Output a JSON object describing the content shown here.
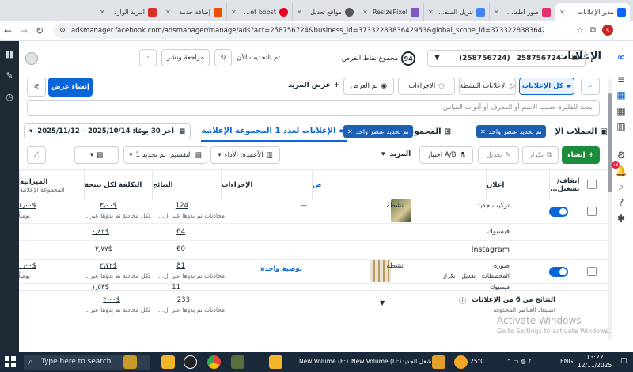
{
  "browser": {
    "tabs": [
      {
        "label": "مدير الإعلانات",
        "active": true,
        "color": "#0866ff"
      },
      {
        "label": "صور أطفال ذكية",
        "color": "#e1306c"
      },
      {
        "label": "تنزيل الملفات",
        "color": "#4285f4"
      },
      {
        "label": "ResizePixel",
        "color": "#7e57c2"
      },
      {
        "label": "مواقع تعديل",
        "color": "#555555"
      },
      {
        "label": "Rocket boost",
        "color": "#e60023"
      },
      {
        "label": "إضافة خدمة",
        "color": "#e65100"
      },
      {
        "label": "البريد الوارد",
        "color": "#d93025"
      }
    ],
    "url": "adsmanager.facebook.com/adsmanager/manage/ads?act=258756724&business_id=3733228383642953&global_scope_id=3733228383642953&date=2...",
    "profile_letter": "s"
  },
  "header": {
    "title": "الإعلانات",
    "account_name": "258756724",
    "account_id": "(258756724)",
    "opportunity_label": "مجموع نقاط الفرص",
    "opportunity_score": "94",
    "updated_text": "تم التحديث الآن",
    "review_button": "مراجعة ونشر"
  },
  "views": {
    "all_ads": "كل الإعلانات",
    "active_ads": "الإعلانات النشطة",
    "actions": "الإجراءات",
    "shown": "تم العرض",
    "more_views": "عرض المزيد",
    "create_view": "إنشاء عرض"
  },
  "search": {
    "placeholder": "بحث للفلترة حسب الاسم أو المعرف أو أدوات القياس"
  },
  "levels": {
    "campaigns": "الحملات الإ",
    "campaigns_chip": "تم تحديد عنصر واحد",
    "adsets": "المجموعات",
    "adsets_chip": "تم تحديد عنصر واحد",
    "ads": "الإعلانات لعدد 1 المجموعة الإعلانية",
    "date_range": "آخر 30 يومًا: 2025/10/14 – 2025/11/12"
  },
  "toolbar": {
    "create": "إنشاء",
    "duplicate": "تكرار",
    "edit": "تعديل",
    "ab_test": "اختبار A/B",
    "more": "المزيد",
    "columns": "الأعمدة: الأداء",
    "breakdown": "التقسيم: تم تحديد 1"
  },
  "table": {
    "headers": {
      "toggle": "إيقاف/تشغيل...",
      "ad": "إعلان",
      "delivery": "ض",
      "actions": "الإجراءات",
      "results": "النتائج",
      "cost": "التكلفة لكل نتيجة",
      "budget": "الميزانية",
      "budget_sub": "المجموعة الإعلانية"
    },
    "rows": [
      {
        "name": "تركيب جديد",
        "delivery": "نشطة",
        "actions": "—",
        "results": "124",
        "results_sub": "محادثات تم بدؤها عبر ال...",
        "cost": "$٣٫٠٠",
        "cost_sub": "لكل محادثة تم بدؤها عبر...",
        "budget": "$٤٫٠٠",
        "budget_sub": "يومياً"
      },
      {
        "name": "فيسبوك",
        "results": "64",
        "cost": "$٠٫٨٢"
      },
      {
        "name": "Instagram",
        "results": "60",
        "cost": "$٣٫٧٧"
      },
      {
        "name": "صورة",
        "delivery": "نشطة",
        "actions": "توصية واحدة",
        "results": "81",
        "results_sub": "محادثات تم بدؤها عبر ال...",
        "cost": "$٣٫٧٢",
        "cost_sub": "لكل محادثة تم بدؤها عبر...",
        "budget": "$٣٠٫٠٠",
        "budget_sub": "يومياً",
        "row_actions": [
          "المخططات",
          "تعديل",
          "تكرار"
        ]
      },
      {
        "name": "فيسبوك",
        "results": "11",
        "cost": "$١٫٥٣"
      }
    ],
    "footer": {
      "title": "النتائج من 6 من الإعلانات",
      "subtitle": "استبعاد العناصر المحذوفة",
      "results": "233",
      "results_sub": "محادثات تم بدؤها عبر ال...",
      "cost": "$٣٫٠٠",
      "cost_sub": "لكل محادثة تم بدؤها عبر..."
    }
  },
  "system": {
    "watermark": "Activate Windows",
    "watermark_sub": "Go to Settings to activate Windows.",
    "search_placeholder": "Type here to search",
    "temp": "25°C",
    "lang": "ENG",
    "time": "13:22",
    "date": "12/11/2025",
    "taskbar_items": [
      "New Volume (E:)",
      "New Volume (D:)",
      "الشغل الجديد"
    ],
    "notification_count": "١٥"
  },
  "colors": {
    "primary": "#0a66d8",
    "create": "#1b8c3c",
    "sidebar_dark": "#1f2a36",
    "taskbar": "#1b2a3a"
  }
}
